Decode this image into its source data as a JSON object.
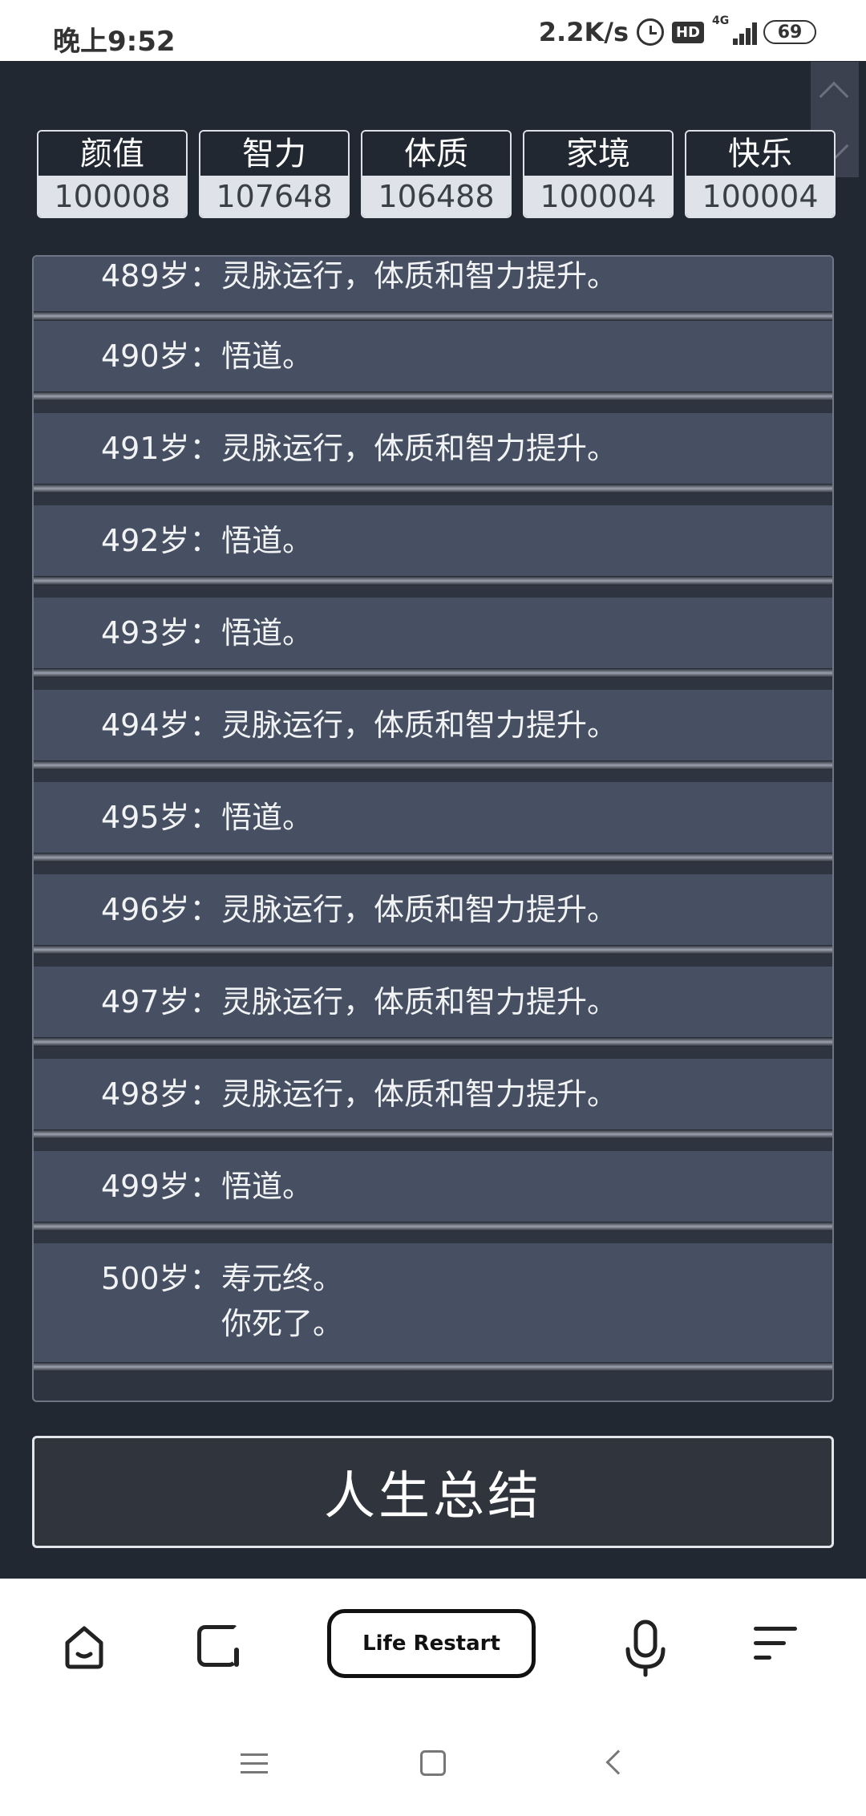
{
  "status_bar": {
    "time": "晚上9:52",
    "net_speed": "2.2K/s",
    "hd_label": "HD",
    "network_type": "4G",
    "battery": "69"
  },
  "stats": [
    {
      "label": "颜值",
      "value": "100008"
    },
    {
      "label": "智力",
      "value": "107648"
    },
    {
      "label": "体质",
      "value": "106488"
    },
    {
      "label": "家境",
      "value": "100004"
    },
    {
      "label": "快乐",
      "value": "100004"
    }
  ],
  "events": [
    {
      "age": "489岁：",
      "text": "灵脉运行，体质和智力提升。"
    },
    {
      "age": "490岁：",
      "text": "悟道。"
    },
    {
      "age": "491岁：",
      "text": "灵脉运行，体质和智力提升。"
    },
    {
      "age": "492岁：",
      "text": "悟道。"
    },
    {
      "age": "493岁：",
      "text": "悟道。"
    },
    {
      "age": "494岁：",
      "text": "灵脉运行，体质和智力提升。"
    },
    {
      "age": "495岁：",
      "text": "悟道。"
    },
    {
      "age": "496岁：",
      "text": "灵脉运行，体质和智力提升。"
    },
    {
      "age": "497岁：",
      "text": "灵脉运行，体质和智力提升。"
    },
    {
      "age": "498岁：",
      "text": "灵脉运行，体质和智力提升。"
    },
    {
      "age": "499岁：",
      "text": "悟道。"
    },
    {
      "age": "500岁：",
      "text": "寿元终。",
      "text2": "你死了。"
    }
  ],
  "summary_button": "人生总结",
  "browser_bar": {
    "title": "Life Restart"
  },
  "colors": {
    "game_background": "#222831",
    "event_background": "#475062",
    "stat_value_background": "#dfe2e8"
  }
}
